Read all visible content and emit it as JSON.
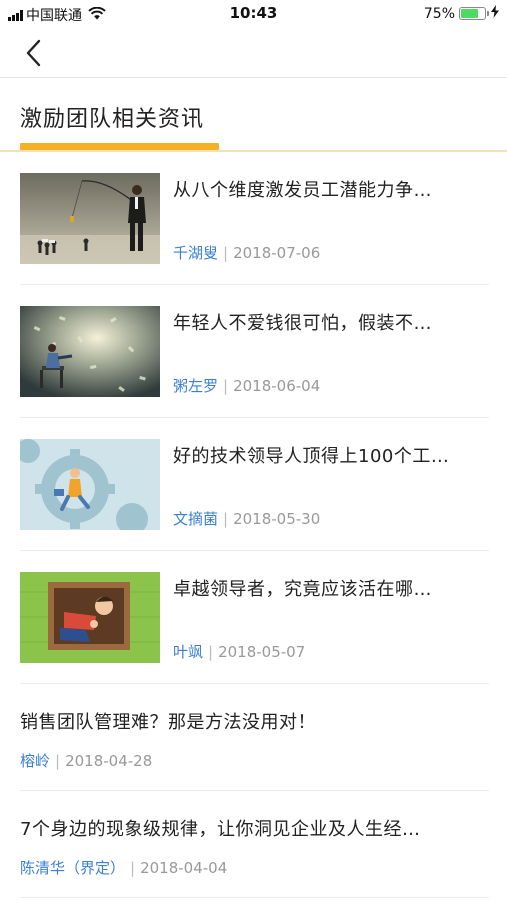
{
  "status_bar": {
    "carrier": "中国联通",
    "time": "10:43",
    "battery": "75%",
    "battery_level": 0.75,
    "icons": [
      "signal-icon",
      "wifi-icon",
      "battery-icon",
      "charging-icon"
    ]
  },
  "nav": {
    "back_icon": "chevron-left-icon"
  },
  "section": {
    "title": "激励团队相关资讯",
    "accent_color": "#f5b025"
  },
  "articles": [
    {
      "title": "从八个维度激发员工潜能力争…",
      "author": "千湖叟",
      "separator": "|",
      "date": "2018-07-06",
      "has_thumbnail": true
    },
    {
      "title": "年轻人不爱钱很可怕，假装不…",
      "author": "粥左罗",
      "separator": "|",
      "date": "2018-06-04",
      "has_thumbnail": true
    },
    {
      "title": "好的技术领导人顶得上100个工…",
      "author": "文摘菌",
      "separator": "|",
      "date": "2018-05-30",
      "has_thumbnail": true
    },
    {
      "title": "卓越领导者，究竟应该活在哪…",
      "author": "叶飒",
      "separator": "|",
      "date": "2018-05-07",
      "has_thumbnail": true
    },
    {
      "title": "销售团队管理难？那是方法没用对！",
      "author": "榕岭",
      "separator": "|",
      "date": "2018-04-28",
      "has_thumbnail": false
    },
    {
      "title": "7个身边的现象级规律，让你洞见企业及人生经…",
      "author": "陈清华（界定）",
      "separator": "|",
      "date": "2018-04-04",
      "has_thumbnail": false
    }
  ],
  "colors": {
    "author_link": "#3a7fd5",
    "meta_gray": "#999999",
    "divider": "#ececec"
  }
}
